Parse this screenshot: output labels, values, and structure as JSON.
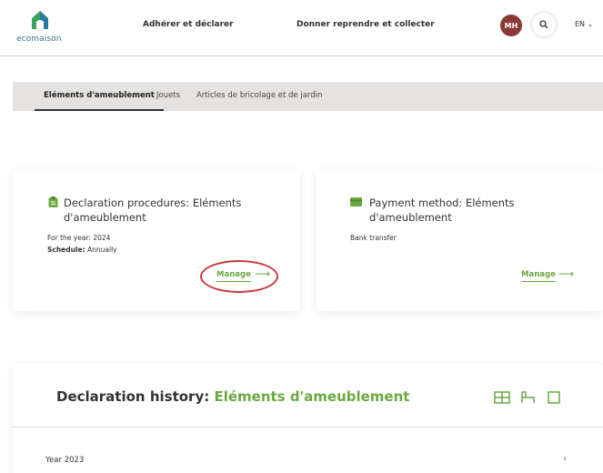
{
  "header": {
    "logo_text": "ecomaison",
    "nav": [
      "Adhérer et déclarer",
      "Donner reprendre et collecter"
    ],
    "avatar_initials": "MH",
    "language": "EN"
  },
  "tabs": [
    {
      "label": "Eléments d'ameublement",
      "active": true
    },
    {
      "label": "Jouets",
      "active": false
    },
    {
      "label": "Articles de bricolage et de jardin",
      "active": false
    }
  ],
  "declaration_card": {
    "title_line1": "Declaration procedures: Eléments",
    "title_line2": "d'ameublement",
    "year_label": "For the year:",
    "year_value": "2024",
    "schedule_label": "Schedule:",
    "schedule_value": "Annually",
    "action": "Manage"
  },
  "payment_card": {
    "title_line1": "Payment method: Eléments",
    "title_line2": "d'ameublement",
    "method": "Bank transfer",
    "action": "Manage"
  },
  "history": {
    "title": "Declaration history:",
    "title_accent": "Eléments d'ameublement",
    "rows": [
      {
        "label": "Year 2023"
      }
    ]
  },
  "colors": {
    "accent": "#6aa842",
    "avatar": "#8b3a33",
    "highlight": "#c8383f",
    "tabbar": "#e5e3e1"
  }
}
